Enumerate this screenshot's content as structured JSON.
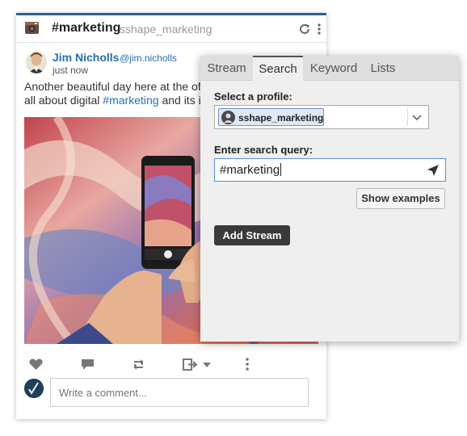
{
  "stream": {
    "title": "#marketing",
    "subtitle": "sshape_marketing",
    "post": {
      "author_name": "Jim Nicholls",
      "author_handle": "@jim.nicholls",
      "time": "just now",
      "text_before": "Another beautiful day here at the office!",
      "text_line2_before": "all about digital ",
      "hashtag": "#marketing",
      "text_after": " and its impa"
    },
    "comment_placeholder": "Write a comment..."
  },
  "panel": {
    "tabs": [
      {
        "label": "Stream"
      },
      {
        "label": "Search",
        "active": true
      },
      {
        "label": "Keyword"
      },
      {
        "label": "Lists"
      }
    ],
    "profile_label": "Select a profile:",
    "selected_profile": "sshape_marketing",
    "query_label": "Enter search query:",
    "query_value": "#marketing",
    "examples_button": "Show examples",
    "add_button": "Add Stream"
  },
  "colors": {
    "link": "#2a6db5",
    "header_accent": "#2f5f92",
    "button_dark": "#3a3a3a"
  }
}
